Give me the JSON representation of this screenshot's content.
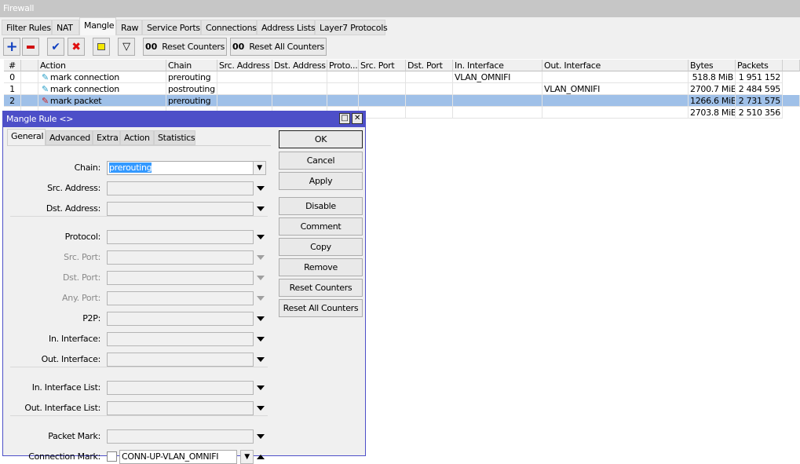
{
  "window": {
    "title": "Firewall"
  },
  "tabs": [
    "Filter Rules",
    "NAT",
    "Mangle",
    "Raw",
    "Service Ports",
    "Connections",
    "Address Lists",
    "Layer7 Protocols"
  ],
  "active_tab": "Mangle",
  "toolbar": {
    "reset_counters": "Reset Counters",
    "reset_all_counters": "Reset All Counters",
    "counter_glyph": "00"
  },
  "table": {
    "columns": [
      "#",
      "",
      "Action",
      "Chain",
      "Src. Address",
      "Dst. Address",
      "Proto...",
      "Src. Port",
      "Dst. Port",
      "In. Interface",
      "Out. Interface",
      "Bytes",
      "Packets"
    ],
    "rows": [
      {
        "num": "0",
        "action": "mark connection",
        "icon": "pencil-blue",
        "chain": "prerouting",
        "in": "VLAN_OMNIFI",
        "out": "",
        "bytes": "518.8 MiB",
        "packets": "1 951 152"
      },
      {
        "num": "1",
        "action": "mark connection",
        "icon": "pencil-blue",
        "chain": "postrouting",
        "in": "",
        "out": "VLAN_OMNIFI",
        "bytes": "2700.7 MiB",
        "packets": "2 484 595"
      },
      {
        "num": "2",
        "action": "mark packet",
        "icon": "pencil-red",
        "chain": "prerouting",
        "in": "",
        "out": "",
        "bytes": "1266.6 MiB",
        "packets": "2 731 575",
        "selected": true
      },
      {
        "num": "",
        "action": "",
        "chain": "",
        "in": "",
        "out": "",
        "bytes": "2703.8 MiB",
        "packets": "2 510 356"
      }
    ]
  },
  "dialog": {
    "title": "Mangle Rule <>",
    "tabs": [
      "General",
      "Advanced",
      "Extra",
      "Action",
      "Statistics"
    ],
    "fields": [
      {
        "label": "Chain:",
        "value": "prerouting",
        "active": true
      },
      {
        "label": "Src. Address:",
        "value": ""
      },
      {
        "label": "Dst. Address:",
        "value": ""
      },
      {
        "label": "Protocol:",
        "value": ""
      },
      {
        "label": "Src. Port:",
        "value": "",
        "disabled": true
      },
      {
        "label": "Dst. Port:",
        "value": "",
        "disabled": true
      },
      {
        "label": "Any. Port:",
        "value": "",
        "disabled": true
      },
      {
        "label": "P2P:",
        "value": ""
      },
      {
        "label": "In. Interface:",
        "value": ""
      },
      {
        "label": "Out. Interface:",
        "value": ""
      },
      {
        "label": "In. Interface List:",
        "value": ""
      },
      {
        "label": "Out. Interface List:",
        "value": ""
      },
      {
        "label": "Packet Mark:",
        "value": ""
      },
      {
        "label": "Connection Mark:",
        "value": "CONN-UP-VLAN_OMNIFI"
      }
    ],
    "buttons": [
      "OK",
      "Cancel",
      "Apply",
      "Disable",
      "Comment",
      "Copy",
      "Remove",
      "Reset Counters",
      "Reset All Counters"
    ]
  },
  "colors": {
    "title_bar": "#4d4fc8",
    "selection": "#9fc0e8",
    "selected_text": "#3399ff"
  }
}
